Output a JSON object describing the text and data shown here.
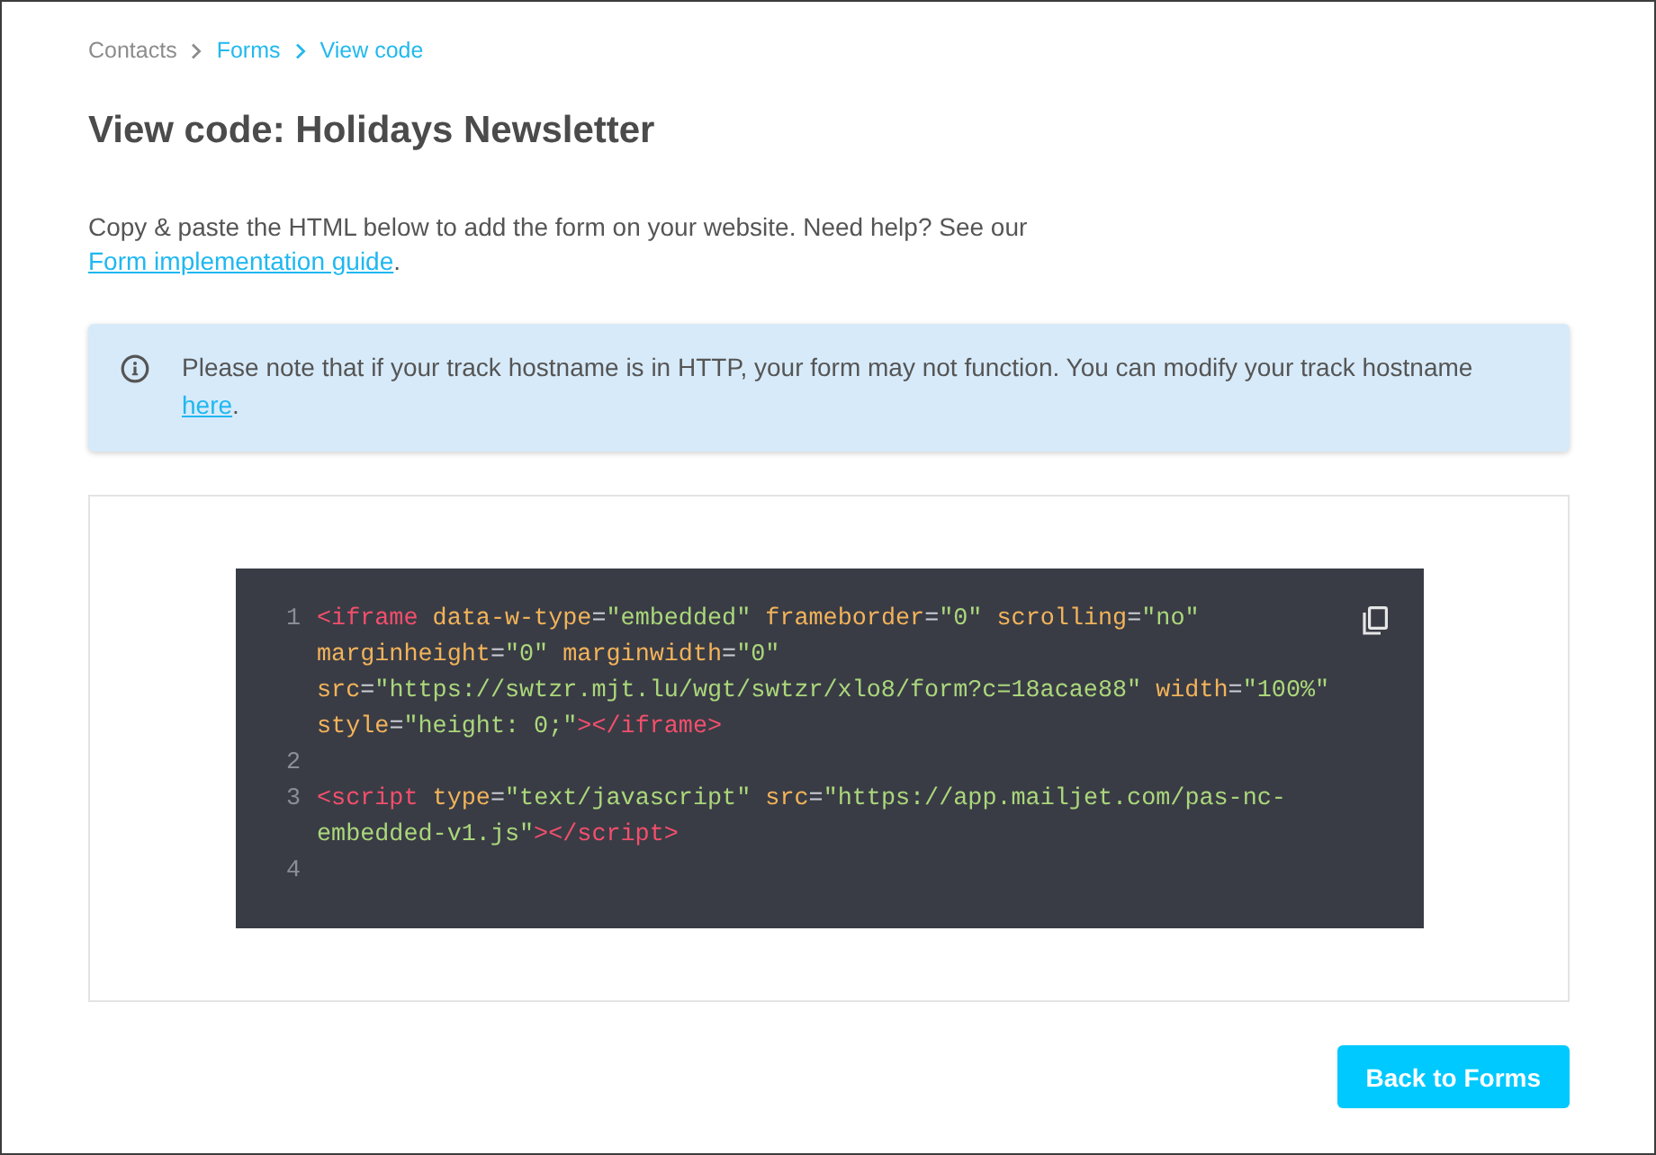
{
  "breadcrumb": [
    {
      "label": "Contacts",
      "kind": "text"
    },
    {
      "label": "Forms",
      "kind": "link"
    },
    {
      "label": "View code",
      "kind": "link"
    }
  ],
  "title": "View code: Holidays Newsletter",
  "intro": {
    "text": "Copy & paste the HTML below to add the form on your website. Need help? See our",
    "link": "Form implementation guide",
    "after": "."
  },
  "alert": {
    "text": "Please note that if your track hostname is in HTTP, your form may not function. You can modify your track hostname",
    "link": "here",
    "after": "."
  },
  "code": {
    "lines": [
      {
        "number": "1",
        "rows": [
          "<iframe data-w-type=\"embedded\" frameborder=\"0\" scrolling=\"no\"",
          "marginheight=\"0\" marginwidth=\"0\"",
          "src=\"https://swtzr.mjt.lu/wgt/swtzr/xlo8/form?c=18acae88\" width=\"100%\"",
          "style=\"height: 0;\"></iframe>"
        ]
      },
      {
        "number": "2"
      },
      {
        "number": "3",
        "rows": [
          "<script type=\"text/javascript\" src=\"https://app.mailjet.com/pas-nc-",
          "embedded-v1.js\"></script>"
        ]
      },
      {
        "number": "4"
      }
    ]
  },
  "buttons": [
    {
      "label": "Back to Forms"
    }
  ]
}
